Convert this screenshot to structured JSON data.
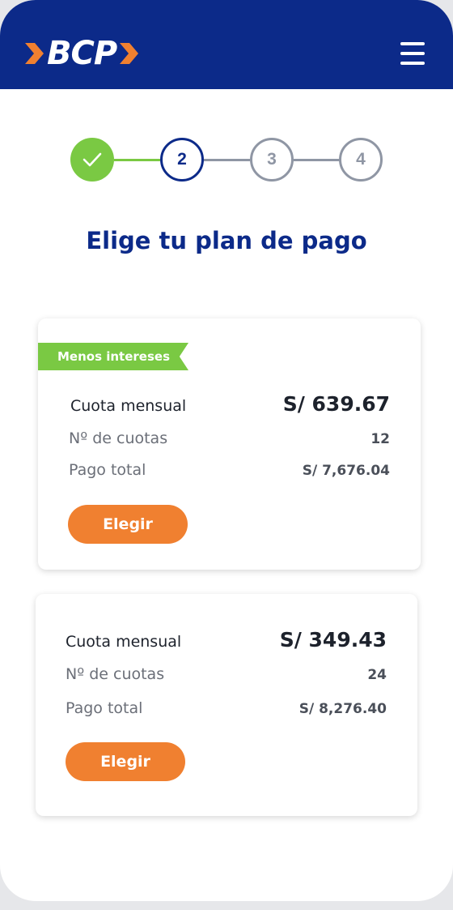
{
  "header": {
    "brand": "BCP",
    "logo_accent_color": "#f08030",
    "bar_color": "#0c2a89",
    "menu_icon": "hamburger-menu-icon"
  },
  "stepper": {
    "steps": [
      {
        "label": "",
        "state": "done",
        "icon": "check-icon"
      },
      {
        "label": "2",
        "state": "active"
      },
      {
        "label": "3",
        "state": "pending"
      },
      {
        "label": "4",
        "state": "pending"
      }
    ],
    "done_color": "#7ac943",
    "active_color": "#0c2a89",
    "pending_color": "#8f96a4"
  },
  "page": {
    "title": "Elige tu plan de pago"
  },
  "plans": [
    {
      "badge": "Menos intereses",
      "monthly_label": "Cuota mensual",
      "monthly_value": "S/ 639.67",
      "count_label": "Nº de cuotas",
      "count_value": "12",
      "total_label": "Pago total",
      "total_value": "S/ 7,676.04",
      "button_label": "Elegir"
    },
    {
      "monthly_label": "Cuota mensual",
      "monthly_value": "S/ 349.43",
      "count_label": "Nº de cuotas",
      "count_value": "24",
      "total_label": "Pago total",
      "total_value": "S/ 8,276.40",
      "button_label": "Elegir"
    }
  ],
  "colors": {
    "button": "#f08030",
    "badge": "#7ac943",
    "title": "#0c2a89"
  }
}
